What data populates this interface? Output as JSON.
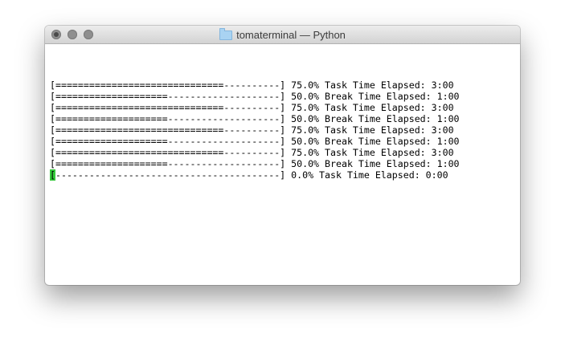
{
  "window": {
    "title": "tomaterminal — Python",
    "folder_icon": "folder-icon"
  },
  "terminal": {
    "lines": [
      "[==============================----------] 75.0% Task Time Elapsed: 3:00",
      "[====================--------------------] 50.0% Break Time Elapsed: 1:00",
      "[==============================----------] 75.0% Task Time Elapsed: 3:00",
      "[====================--------------------] 50.0% Break Time Elapsed: 1:00",
      "[==============================----------] 75.0% Task Time Elapsed: 3:00",
      "[====================--------------------] 50.0% Break Time Elapsed: 1:00",
      "[==============================----------] 75.0% Task Time Elapsed: 3:00",
      "[====================--------------------] 50.0% Break Time Elapsed: 1:00"
    ],
    "current_line": {
      "cursor_char": "[",
      "rest": "----------------------------------------] 0.0% Task Time Elapsed: 0:00"
    },
    "cursor_color": "#33c73a"
  }
}
